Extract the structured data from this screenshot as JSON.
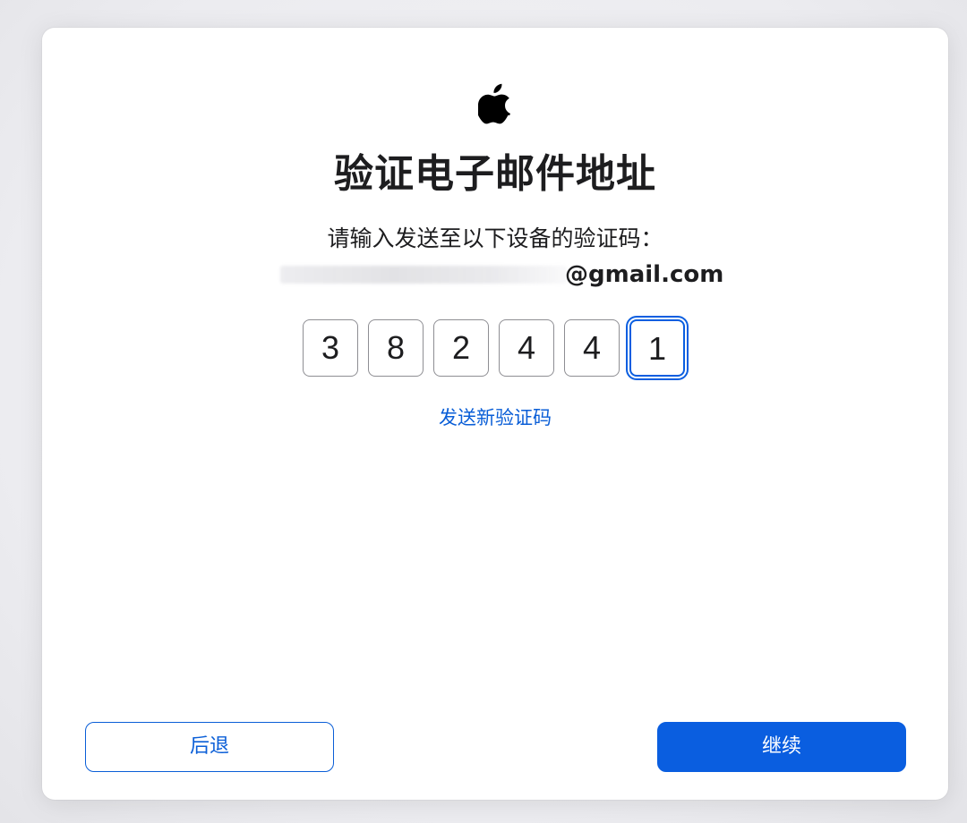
{
  "icons": {
    "logo": "apple-logo-icon"
  },
  "dialog": {
    "title": "验证电子邮件地址",
    "subtitle": "请输入发送至以下设备的验证码：",
    "email_domain": "@gmail.com",
    "code_digits": [
      "3",
      "8",
      "2",
      "4",
      "4",
      "1"
    ],
    "active_digit_index": 5,
    "resend_label": "发送新验证码",
    "back_label": "后退",
    "continue_label": "继续"
  },
  "colors": {
    "accent": "#0a5ee0",
    "text": "#1d1d1f",
    "border": "#8e8e93",
    "background": "#ffffff"
  }
}
